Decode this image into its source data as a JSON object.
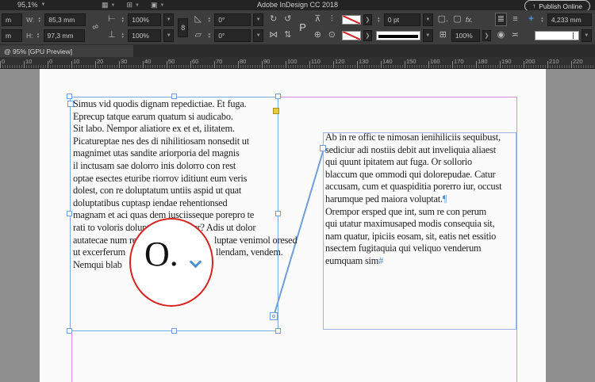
{
  "app": {
    "title": "Adobe InDesign CC 2018",
    "zoom_level": "95,1%",
    "publish_label": "Publish Online"
  },
  "control_panel": {
    "x_value": "m",
    "y_value": "m",
    "w_label": "W:",
    "w_value": "85,3 mm",
    "h_label": "H:",
    "h_value": "97,3 mm",
    "scale_x_value": "100%",
    "scale_y_value": "100%",
    "rotation_value": "0°",
    "shear_value": "0°",
    "reference_point_label": "P",
    "constrain_label": "8",
    "stroke_weight_value": "0 pt",
    "effects_label": "fx.",
    "opacity_value": "100%",
    "gap_value": "4,233 mm"
  },
  "tab_bar": {
    "active_tab": "@ 95% [GPU Preview]"
  },
  "ruler": {
    "labels": [
      "0",
      "10",
      "0",
      "10",
      "20",
      "30",
      "40",
      "50",
      "60",
      "70",
      "80",
      "90",
      "100",
      "110",
      "120",
      "130",
      "140",
      "150",
      "160",
      "170",
      "180",
      "190",
      "200",
      "210",
      "220"
    ]
  },
  "document": {
    "left_lines": [
      "Simus vid quodis dignam repedictiae. Et fuga.",
      "Eprecup tatque earum quatum si audicabo.",
      "Sit labo. Nempor aliatiore ex et et, ilitatem.",
      "Picatureptae nes des di nihilitiosam nonsedit ut",
      "magnimet utas sandite ariorporia del magnis",
      "il inctusam sae dolorro inis dolorro con rest",
      "optae esectes eturibe riorrov iditiunt eum veris",
      "dolest, con re doluptatum untiis aspid ut quat",
      "doluptatibus cuptasp iendae rehentionsed",
      "magnam et aci quas dem iusciisseque porepro te",
      "rati to voloris doluptae pra adiatur? Adis ut dolor"
    ],
    "line12_left": "autatecae num re",
    "line12_right": "luptae venimol oresed",
    "line13_left": "ut excerferum",
    "line13_right": "llendam, vendem.",
    "line14": "Nemqui blab",
    "right_lines": [
      "Ab in re offic te nimosan ienihiliciis sequibust,",
      "sediciur adi nostiis debit aut inveliquia aliaest",
      "qui quunt ipitatem aut fuga. Or sollorio",
      "blaccum que ommodi qui dolorepudae. Catur",
      "accusam, cum et quaspiditia porerro iur, occust",
      "harumque ped maiora voluptat."
    ],
    "pilcrow": "¶",
    "right_lines2": [
      "Orempor ersped que int, sum re con perum",
      "qui utatur maximusaped modis consequia sit,",
      "nam quatur, ipiciis eosam, sit, eatis net essitio",
      "nsectem fugitaquia qui veliquo venderum",
      "eumquam sim"
    ],
    "end_marker": "#",
    "magnifier_glyph": "O."
  },
  "colors": {
    "accent_blue": "#4e8fd3",
    "frame_blue": "#6f9ed9",
    "guide_pink": "#d98cd8",
    "annotation_red": "#d7221f",
    "handle_yellow": "#e5cb3e"
  }
}
